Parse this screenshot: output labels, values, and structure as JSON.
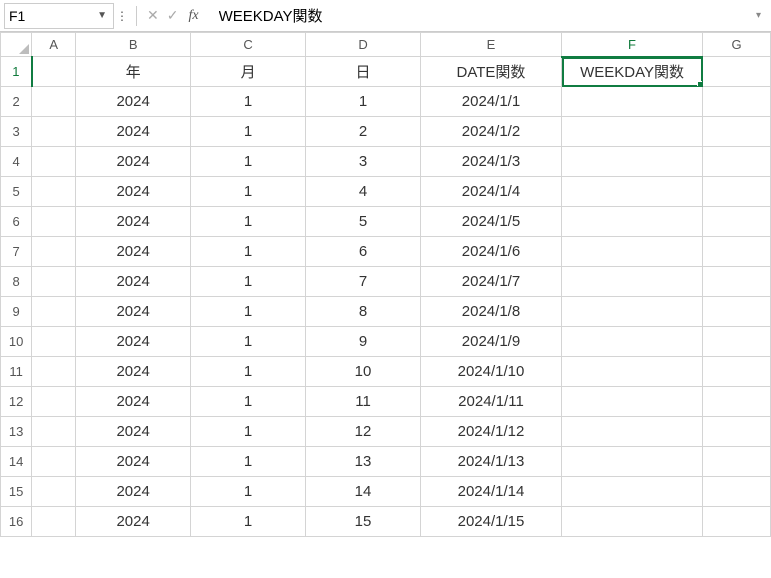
{
  "formula_bar": {
    "name_box": "F1",
    "formula_value": "WEEKDAY関数"
  },
  "columns": [
    "A",
    "B",
    "C",
    "D",
    "E",
    "F",
    "G"
  ],
  "selected_col": "F",
  "selected_row": 1,
  "row_count": 16,
  "headers": {
    "B": "年",
    "C": "月",
    "D": "日",
    "E": "DATE関数",
    "F": "WEEKDAY関数"
  },
  "rows": [
    {
      "B": "2024",
      "C": "1",
      "D": "1",
      "E": "2024/1/1"
    },
    {
      "B": "2024",
      "C": "1",
      "D": "2",
      "E": "2024/1/2"
    },
    {
      "B": "2024",
      "C": "1",
      "D": "3",
      "E": "2024/1/3"
    },
    {
      "B": "2024",
      "C": "1",
      "D": "4",
      "E": "2024/1/4"
    },
    {
      "B": "2024",
      "C": "1",
      "D": "5",
      "E": "2024/1/5"
    },
    {
      "B": "2024",
      "C": "1",
      "D": "6",
      "E": "2024/1/6"
    },
    {
      "B": "2024",
      "C": "1",
      "D": "7",
      "E": "2024/1/7"
    },
    {
      "B": "2024",
      "C": "1",
      "D": "8",
      "E": "2024/1/8"
    },
    {
      "B": "2024",
      "C": "1",
      "D": "9",
      "E": "2024/1/9"
    },
    {
      "B": "2024",
      "C": "1",
      "D": "10",
      "E": "2024/1/10"
    },
    {
      "B": "2024",
      "C": "1",
      "D": "11",
      "E": "2024/1/11"
    },
    {
      "B": "2024",
      "C": "1",
      "D": "12",
      "E": "2024/1/12"
    },
    {
      "B": "2024",
      "C": "1",
      "D": "13",
      "E": "2024/1/13"
    },
    {
      "B": "2024",
      "C": "1",
      "D": "14",
      "E": "2024/1/14"
    },
    {
      "B": "2024",
      "C": "1",
      "D": "15",
      "E": "2024/1/15"
    }
  ]
}
